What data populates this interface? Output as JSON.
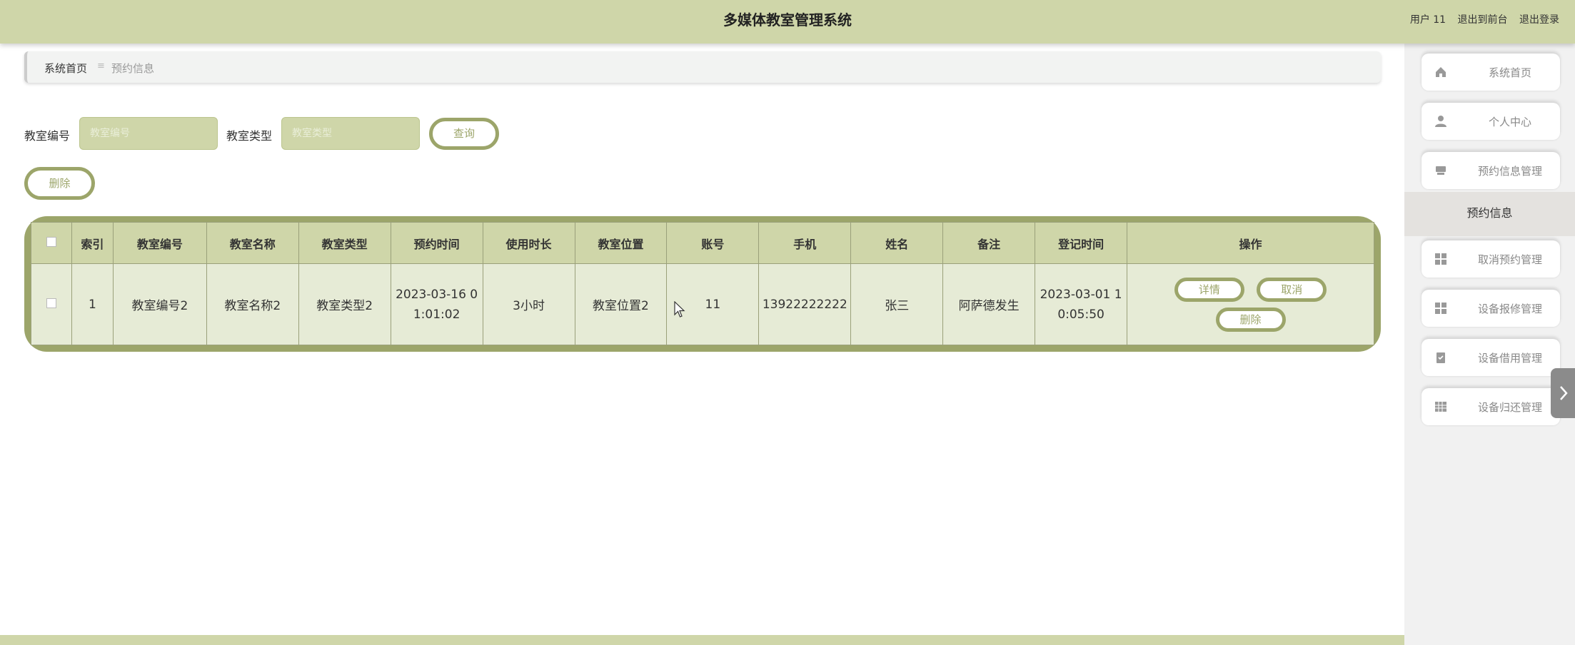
{
  "header": {
    "title": "多媒体教室管理系统",
    "user": "用户 11",
    "to_front": "退出到前台",
    "logout": "退出登录"
  },
  "breadcrumb": {
    "home": "系统首页",
    "separator": "≡",
    "current": "预约信息"
  },
  "search": {
    "room_no_label": "教室编号",
    "room_no_placeholder": "教室编号",
    "room_type_label": "教室类型",
    "room_type_placeholder": "教室类型",
    "query_button": "查询"
  },
  "actions": {
    "delete_button": "删除"
  },
  "table": {
    "headers": [
      "索引",
      "教室编号",
      "教室名称",
      "教室类型",
      "预约时间",
      "使用时长",
      "教室位置",
      "账号",
      "手机",
      "姓名",
      "备注",
      "登记时间",
      "操作"
    ],
    "rows": [
      {
        "index": "1",
        "room_no": "教室编号2",
        "room_name": "教室名称2",
        "room_type": "教室类型2",
        "reserve_time_1": "2023-03-16 0",
        "reserve_time_2": "1:01:02",
        "duration": "3小时",
        "location": "教室位置2",
        "account": "11",
        "phone": "13922222222",
        "name": "张三",
        "remark": "阿萨德发生",
        "register_time_1": "2023-03-01 1",
        "register_time_2": "0:05:50",
        "detail_button": "详情",
        "cancel_button": "取消",
        "delete_button": "删除"
      }
    ]
  },
  "sidebar": {
    "items": [
      {
        "label": "系统首页",
        "icon": "home-icon"
      },
      {
        "label": "个人中心",
        "icon": "user-icon"
      },
      {
        "label": "预约信息管理",
        "icon": "desk-icon"
      },
      {
        "label": "取消预约管理",
        "icon": "grid-icon"
      },
      {
        "label": "设备报修管理",
        "icon": "grid-icon"
      },
      {
        "label": "设备借用管理",
        "icon": "clipboard-icon"
      },
      {
        "label": "设备归还管理",
        "icon": "table-icon"
      }
    ],
    "active_sub": "预约信息"
  },
  "colors": {
    "accent": "#9ca56a",
    "header_bg": "#cfd6a9",
    "row_bg": "#e6ebd6"
  }
}
